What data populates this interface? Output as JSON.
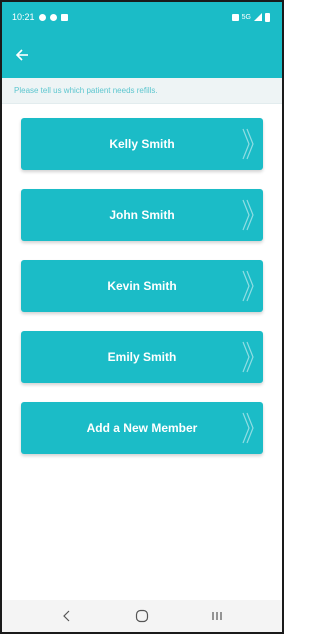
{
  "status_bar": {
    "time": "10:21",
    "network": "5G"
  },
  "header": {
    "back_icon": "arrow-left-icon"
  },
  "prompt": {
    "text": "Please tell us which patient needs refills."
  },
  "members": [
    {
      "label": "Kelly Smith"
    },
    {
      "label": "John Smith"
    },
    {
      "label": "Kevin Smith"
    },
    {
      "label": "Emily Smith"
    },
    {
      "label": "Add a New Member"
    }
  ],
  "colors": {
    "accent": "#1bbcc7",
    "prompt_text": "#5cc6cf",
    "prompt_bg": "#eef4f5"
  },
  "nav_bar": {
    "back_icon": "chevron-left-icon",
    "home_icon": "home-circle-icon",
    "recents_icon": "recents-icon"
  }
}
